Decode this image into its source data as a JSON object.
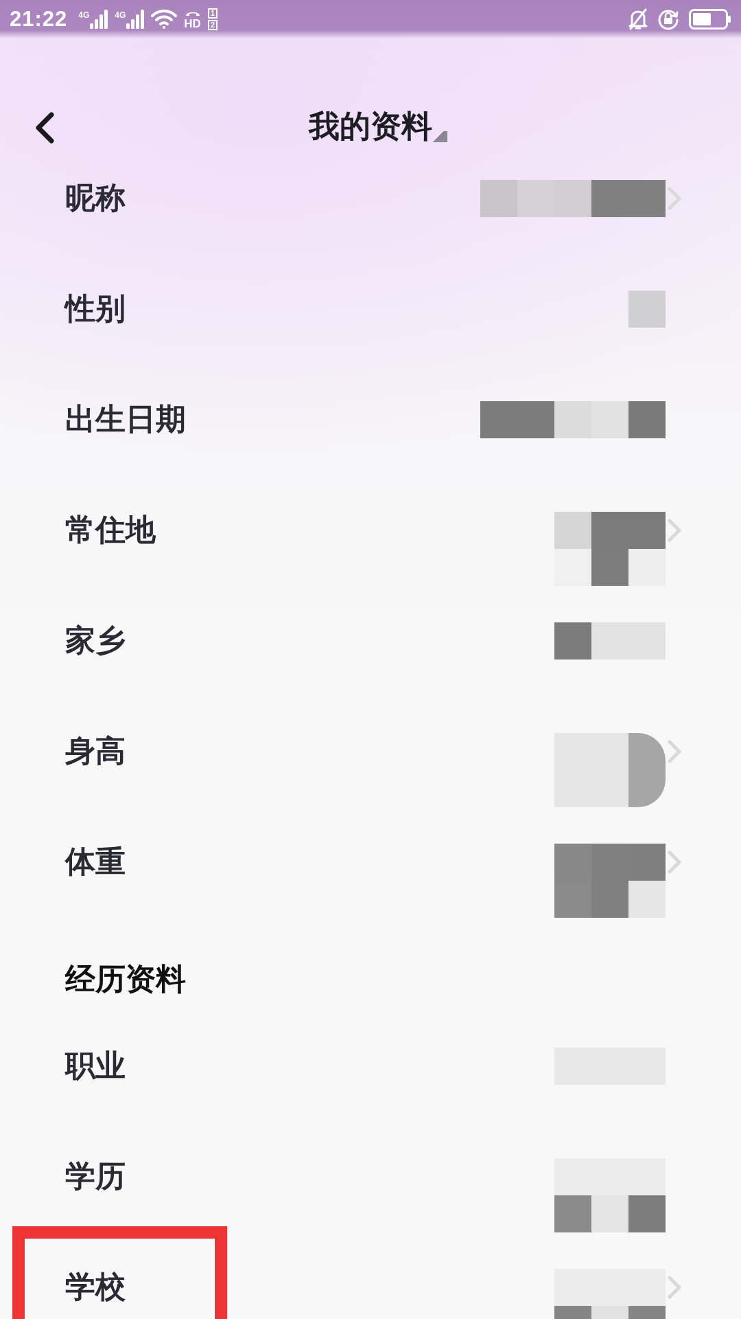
{
  "status_bar": {
    "time": "21:22",
    "networks": [
      {
        "type": "4G"
      },
      {
        "type": "4G"
      }
    ],
    "hd_label": "HD",
    "sim_slots": [
      "1",
      "2"
    ]
  },
  "header": {
    "title": "我的资料"
  },
  "sections": [
    {
      "rows": [
        {
          "label": "昵称",
          "redacted": true,
          "chevron": true,
          "highlighted": false
        },
        {
          "label": "性别",
          "redacted": true,
          "chevron": false,
          "highlighted": false
        },
        {
          "label": "出生日期",
          "redacted": true,
          "chevron": false,
          "highlighted": false
        },
        {
          "label": "常住地",
          "redacted": true,
          "chevron": true,
          "highlighted": false
        },
        {
          "label": "家乡",
          "redacted": true,
          "chevron": false,
          "highlighted": false
        },
        {
          "label": "身高",
          "redacted": true,
          "chevron": true,
          "highlighted": false
        },
        {
          "label": "体重",
          "redacted": true,
          "chevron": true,
          "highlighted": false
        }
      ]
    },
    {
      "title": "经历资料",
      "rows": [
        {
          "label": "职业",
          "redacted": true,
          "chevron": false,
          "highlighted": false
        },
        {
          "label": "学历",
          "redacted": true,
          "chevron": false,
          "highlighted": false
        },
        {
          "label": "学校",
          "redacted": true,
          "chevron": true,
          "highlighted": true
        }
      ]
    }
  ]
}
